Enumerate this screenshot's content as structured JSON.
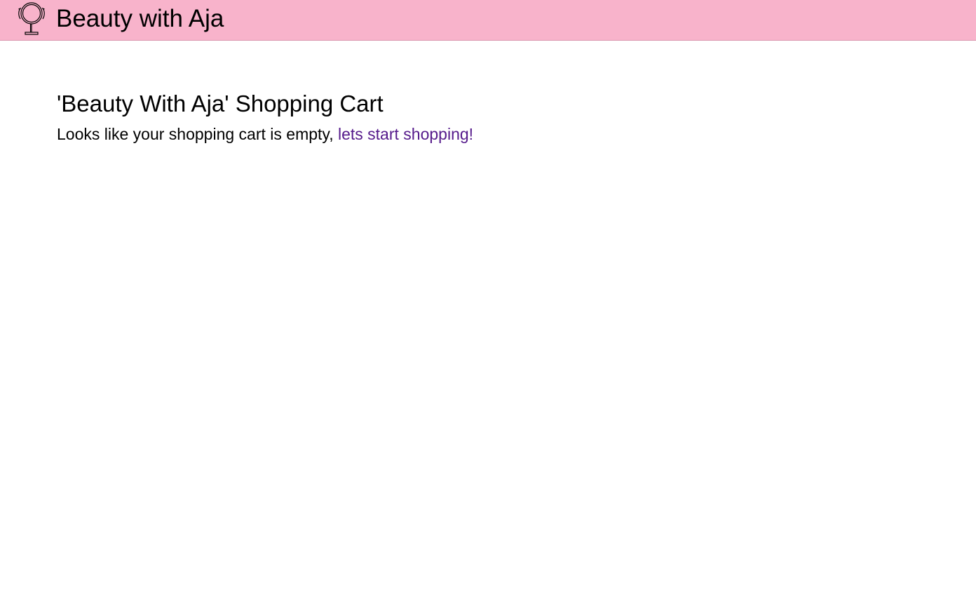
{
  "header": {
    "logo_icon": "vanity-mirror-icon",
    "brand_name": "Beauty with Aja",
    "background_color": "#f8b3cb"
  },
  "cart": {
    "title": "'Beauty With Aja' Shopping Cart",
    "empty_message": "Looks like your shopping cart is empty, ",
    "shop_link_label": "lets start shopping!",
    "link_color": "#551a8b"
  }
}
